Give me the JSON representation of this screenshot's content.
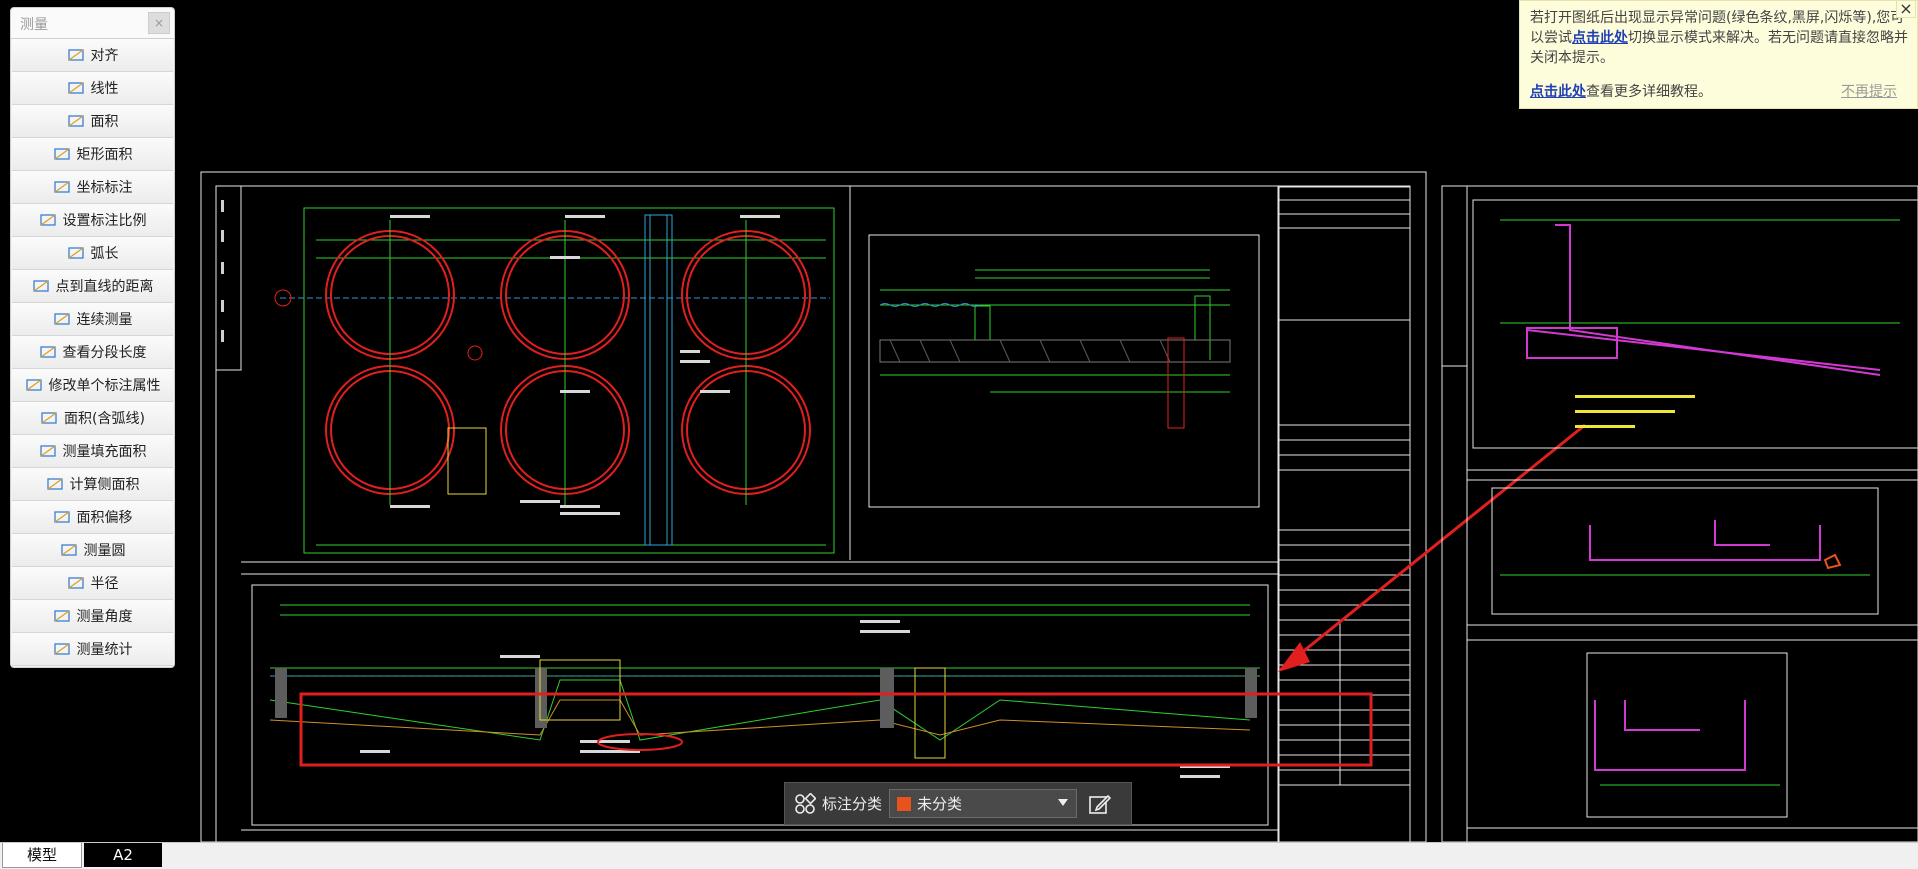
{
  "panel": {
    "title": "测量",
    "close": "×",
    "tools": [
      {
        "label": "对齐",
        "icon": "align-icon"
      },
      {
        "label": "线性",
        "icon": "linear-icon"
      },
      {
        "label": "面积",
        "icon": "area-icon"
      },
      {
        "label": "矩形面积",
        "icon": "rect-area-icon"
      },
      {
        "label": "坐标标注",
        "icon": "coordinate-icon"
      },
      {
        "label": "设置标注比例",
        "icon": "scale-icon"
      },
      {
        "label": "弧长",
        "icon": "arc-length-icon"
      },
      {
        "label": "点到直线的距离",
        "icon": "point-line-distance-icon"
      },
      {
        "label": "连续测量",
        "icon": "continuous-measure-icon"
      },
      {
        "label": "查看分段长度",
        "icon": "segment-length-icon"
      },
      {
        "label": "修改单个标注属性",
        "icon": "edit-dimension-icon"
      },
      {
        "label": "面积(含弧线)",
        "icon": "arc-area-icon"
      },
      {
        "label": "测量填充面积",
        "icon": "fill-area-icon"
      },
      {
        "label": "计算侧面积",
        "icon": "side-area-icon"
      },
      {
        "label": "面积偏移",
        "icon": "area-offset-icon"
      },
      {
        "label": "测量圆",
        "icon": "circle-measure-icon"
      },
      {
        "label": "半径",
        "icon": "radius-icon"
      },
      {
        "label": "测量角度",
        "icon": "angle-icon"
      },
      {
        "label": "测量统计",
        "icon": "statistics-icon"
      }
    ]
  },
  "notice": {
    "text_pre": "若打开图纸后出现显示异常问题(绿色条纹,黑屏,闪烁等),您可以尝试",
    "link1": "点击此处",
    "text_mid": "切换显示模式来解决。若无问题请直接忽略并关闭本提示。",
    "link2": "点击此处",
    "text_more": "查看更多详细教程。",
    "dont_show": "不再提示",
    "close": "×"
  },
  "annotation_bar": {
    "label": "标注分类",
    "selected": "未分类",
    "swatch_color": "#e8531d"
  },
  "tabs": [
    "模型",
    "A2"
  ]
}
